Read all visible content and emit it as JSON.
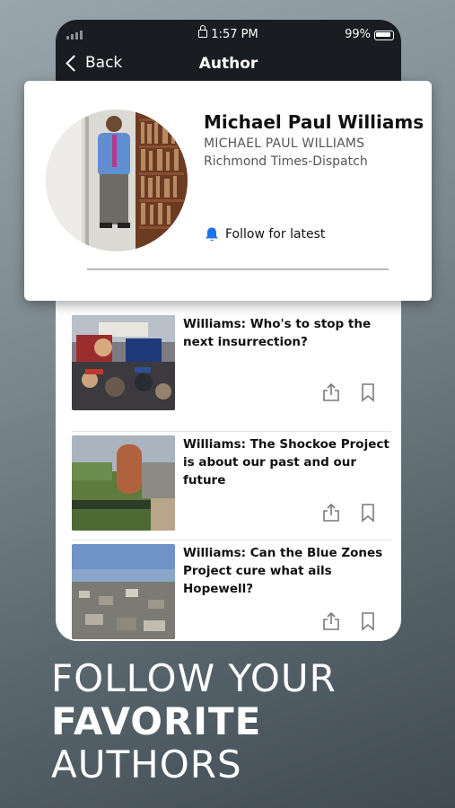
{
  "status_bar": {
    "time": "1:57 PM",
    "battery": "99%"
  },
  "nav": {
    "back_label": "Back",
    "title": "Author"
  },
  "author": {
    "name": "Michael Paul Williams",
    "name_caps": "MICHAEL PAUL WILLIAMS",
    "publication": "Richmond Times-Dispatch",
    "follow_label": "Follow for latest"
  },
  "articles": [
    {
      "title": "Williams: Who's to stop the next insurrection?"
    },
    {
      "title": "Williams: The Shockoe Project is about our past and our future"
    },
    {
      "title": "Williams: Can the Blue Zones Project cure what ails Hopewell?"
    }
  ],
  "tagline": {
    "line1": "FOLLOW YOUR",
    "line2": "FAVORITE",
    "line3": "AUTHORS"
  },
  "colors": {
    "accent": "#1a73e8",
    "dark": "#191c20"
  }
}
